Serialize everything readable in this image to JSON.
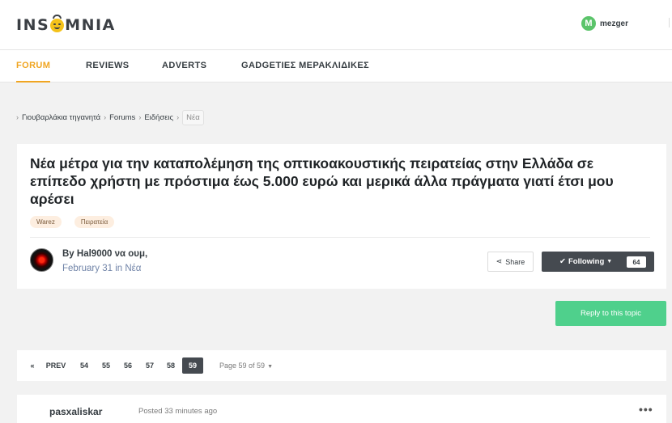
{
  "header": {
    "logo_parts": [
      "INS",
      "MNIA"
    ],
    "user": {
      "initial": "M",
      "name": "mezger",
      "avatar_color": "#5bc46a"
    }
  },
  "nav": {
    "items": [
      {
        "label": "FORUM",
        "active": true
      },
      {
        "label": "REVIEWS"
      },
      {
        "label": "ADVERTS"
      },
      {
        "label": "GADGETΙΕΣ ΜΕΡΑΚΛΙΔΙΚΕΣ"
      }
    ],
    "accent_color": "#f0a521"
  },
  "breadcrumb": {
    "items": [
      "Γιουβαρλάκια τηγανητά",
      "Forums",
      "Ειδήσεις"
    ],
    "current": "Νέα"
  },
  "topic": {
    "title": "Νέα μέτρα για την καταπολέμηση της οπτικοακουστικής πειρατείας στην Ελλάδα σε επίπεδο χρήστη με πρόστιμα έως 5.000 ευρώ και μερικά άλλα πράγματα γιατί έτσι μου αρέσει",
    "tags": [
      "Warez",
      "Πειρατεία"
    ],
    "author_prefix": "By ",
    "author": "Hal9000 να ουμ,",
    "date": "February 31",
    "date_in": " in ",
    "forum": "Νέα",
    "share_label": "Share",
    "following_label": "Following",
    "following_count": "64"
  },
  "reply": {
    "label": "Reply to this topic",
    "color": "#4fd08c"
  },
  "pagination": {
    "first_icon": "«",
    "prev_label": "PREV",
    "pages": [
      "54",
      "55",
      "56",
      "57",
      "58",
      "59"
    ],
    "current": "59",
    "info": "Page 59 of 59"
  },
  "post": {
    "author": "pasxaliskar",
    "time": "Posted 33 minutes ago",
    "menu_icon": "•••"
  }
}
